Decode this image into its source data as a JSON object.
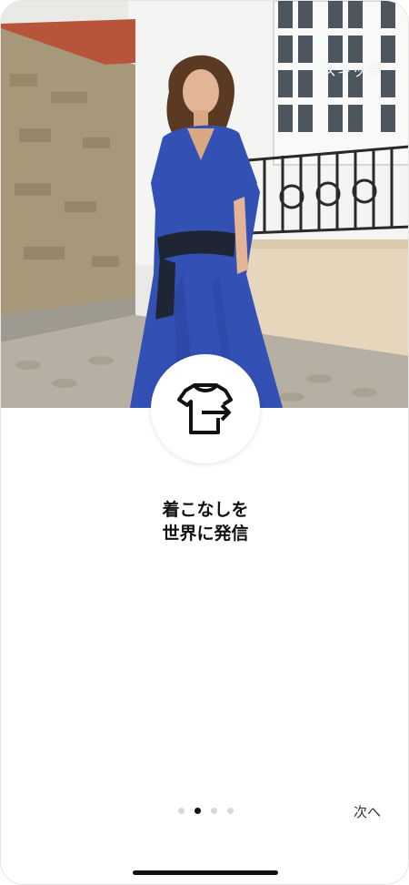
{
  "header": {
    "skip_label": "スキップ"
  },
  "hero": {
    "image_name": "model-in-blue-dress-photo",
    "icon": "shirt-share-icon"
  },
  "content": {
    "title_line1": "着こなしを",
    "title_line2": "世界に発信"
  },
  "pager": {
    "total_pages": 4,
    "current_page": 2
  },
  "footer": {
    "next_label": "次へ"
  },
  "colors": {
    "accent": "#111111",
    "dress_blue": "#3350b5",
    "dot_inactive": "#d8d8d8"
  }
}
